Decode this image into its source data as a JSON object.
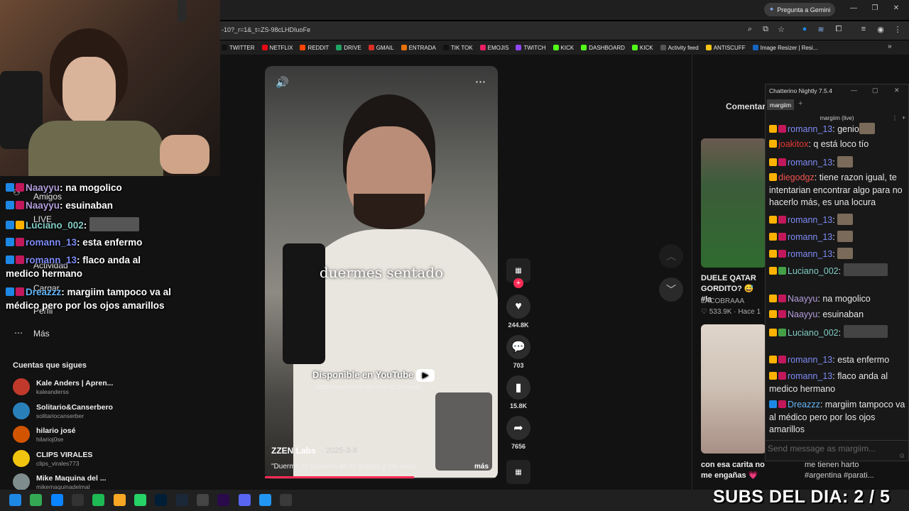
{
  "browser": {
    "gemini_label": "Pregunta a Gemini",
    "url": "-10?_r=1&_t=ZS-98cLHDIuoFe",
    "bookmarks": [
      {
        "label": "TWITTER",
        "color": "#111111"
      },
      {
        "label": "NETFLIX",
        "color": "#e50914"
      },
      {
        "label": "REDDIT",
        "color": "#ff4500"
      },
      {
        "label": "DRIVE",
        "color": "#1fa463"
      },
      {
        "label": "GMAIL",
        "color": "#d93025"
      },
      {
        "label": "ENTRADA",
        "color": "#e8710a"
      },
      {
        "label": "TIK TOK",
        "color": "#111111"
      },
      {
        "label": "EMOJIS",
        "color": "#e91e63"
      },
      {
        "label": "TWITCH",
        "color": "#9146ff"
      },
      {
        "label": "KICK",
        "color": "#53fc18"
      },
      {
        "label": "DASHBOARD",
        "color": "#53fc18"
      },
      {
        "label": "KICK",
        "color": "#53fc18"
      },
      {
        "label": "Activity feed",
        "color": "#555555"
      },
      {
        "label": "ANTISCUFF",
        "color": "#f5c518"
      },
      {
        "label": "Image Resizer | Resi...",
        "color": "#1565c0"
      }
    ]
  },
  "left_nav": {
    "items": [
      {
        "label": "Amigos"
      },
      {
        "label": "LIVE"
      },
      {
        "label": "Actividad"
      },
      {
        "label": "Cargar"
      },
      {
        "label": "Perfil"
      },
      {
        "label": "Más"
      }
    ],
    "follows_title": "Cuentas que sigues",
    "follows": [
      {
        "name": "Kale Anders | Apren...",
        "handle": "kaleanderss",
        "color": "#c0392b"
      },
      {
        "name": "Solitario&Canserbero",
        "handle": "solitariocanserber",
        "color": "#2980b9"
      },
      {
        "name": "hilario josé",
        "handle": "hilarioj0se",
        "color": "#d35400"
      },
      {
        "name": "CLIPS VIRALES",
        "handle": "clips_virales773",
        "color": "#f1c40f"
      },
      {
        "name": "Mike Maquina del ...",
        "handle": "mikemaquinadelmal",
        "color": "#7f8c8d"
      }
    ]
  },
  "overlay_chat": [
    {
      "user": "Naayyu",
      "text": "na mogolico",
      "color": "#b39ddb"
    },
    {
      "user": "Naayyu",
      "text": "esuinaban",
      "color": "#b39ddb"
    },
    {
      "user": "Luciano_002",
      "text": "",
      "color": "#80cbc4"
    },
    {
      "user": "romann_13",
      "text": "esta enfermo",
      "color": "#7e8cf5"
    },
    {
      "user": "romann_13",
      "text": "flaco anda al medico hermano",
      "color": "#7e8cf5"
    },
    {
      "user": "Dreazzz",
      "text": "margiim tampoco va al médico pero por los ojos amarillos",
      "color": "#64b5f6"
    }
  ],
  "video": {
    "caption": "duermes sentado",
    "promo": "Disponible en YouTube",
    "promo_url": "https://www.youtube.com/@zzenlabs",
    "author": "ZZEN Labs",
    "date": "· 2025-3-8",
    "description": "\"Duermo en posición de 90 grados y me estoy",
    "more": "más",
    "actions": {
      "likes": "244.8K",
      "comments": "703",
      "saves": "15.8K",
      "shares": "7656"
    }
  },
  "right": {
    "comments_tab": "Comentari",
    "card1": {
      "title": "DUELE QATAR GORDITO? 😅 #la",
      "author": "LACOBRAAA",
      "stats": "♡ 533.9K · Hace 1"
    },
    "card2": {
      "title": "con esa carita no me engañas 💗",
      "tags": "me tienen harto #argentina #parati..."
    }
  },
  "chatterino": {
    "title": "Chatterino Nightly 7.5.4",
    "tab": "margiim",
    "channel": "margiim (live)",
    "messages": [
      {
        "user": "romann_13",
        "text": "genio",
        "color": "#7e8cf5",
        "emote": true
      },
      {
        "user": "joakitox",
        "text": "q está loco tío",
        "color": "#e53935",
        "emote": false
      },
      {
        "user": "romann_13",
        "text": "",
        "color": "#7e8cf5",
        "emote": true
      },
      {
        "user": "diegodgz",
        "text": "tiene razon igual, te intentarian encontrar algo para no hacerlo más, es una locura",
        "color": "#ef5350",
        "emote": false
      },
      {
        "user": "romann_13",
        "text": "",
        "color": "#7e8cf5",
        "emote": true
      },
      {
        "user": "romann_13",
        "text": "",
        "color": "#7e8cf5",
        "emote": true
      },
      {
        "user": "romann_13",
        "text": "",
        "color": "#7e8cf5",
        "emote": true
      },
      {
        "user": "Luciano_002",
        "text": "",
        "color": "#80cbc4",
        "emote": true
      },
      {
        "user": "Naayyu",
        "text": "na mogolico",
        "color": "#b39ddb",
        "emote": false
      },
      {
        "user": "Naayyu",
        "text": "esuinaban",
        "color": "#b39ddb",
        "emote": false
      },
      {
        "user": "Luciano_002",
        "text": "",
        "color": "#80cbc4",
        "emote": true
      },
      {
        "user": "romann_13",
        "text": "esta enfermo",
        "color": "#7e8cf5",
        "emote": false
      },
      {
        "user": "romann_13",
        "text": "flaco anda al medico hermano",
        "color": "#7e8cf5",
        "emote": false
      },
      {
        "user": "Dreazzz",
        "text": "margiim tampoco va al médico pero por los ojos amarillos",
        "color": "#64b5f6",
        "emote": false
      }
    ],
    "input_placeholder": "Send message as margiim..."
  },
  "subs_overlay": "SUBS DEL DIA: 2 / 5",
  "taskbar": [
    {
      "name": "windows-start-icon",
      "color": "#1e88e5"
    },
    {
      "name": "chrome-icon",
      "color": "#34a853"
    },
    {
      "name": "edge-icon",
      "color": "#0a84ff"
    },
    {
      "name": "obs-icon",
      "color": "#333333"
    },
    {
      "name": "spotify-icon",
      "color": "#1db954"
    },
    {
      "name": "explorer-icon",
      "color": "#f9a825"
    },
    {
      "name": "whatsapp-icon",
      "color": "#25d366"
    },
    {
      "name": "photoshop-icon",
      "color": "#001e36"
    },
    {
      "name": "steam-icon",
      "color": "#1b2838"
    },
    {
      "name": "chatgpt-icon",
      "color": "#444444"
    },
    {
      "name": "premiere-icon",
      "color": "#2a0a4a"
    },
    {
      "name": "discord-icon",
      "color": "#5865f2"
    },
    {
      "name": "notes-icon",
      "color": "#2196f3"
    },
    {
      "name": "chatterino-icon",
      "color": "#3a3a3a"
    }
  ]
}
